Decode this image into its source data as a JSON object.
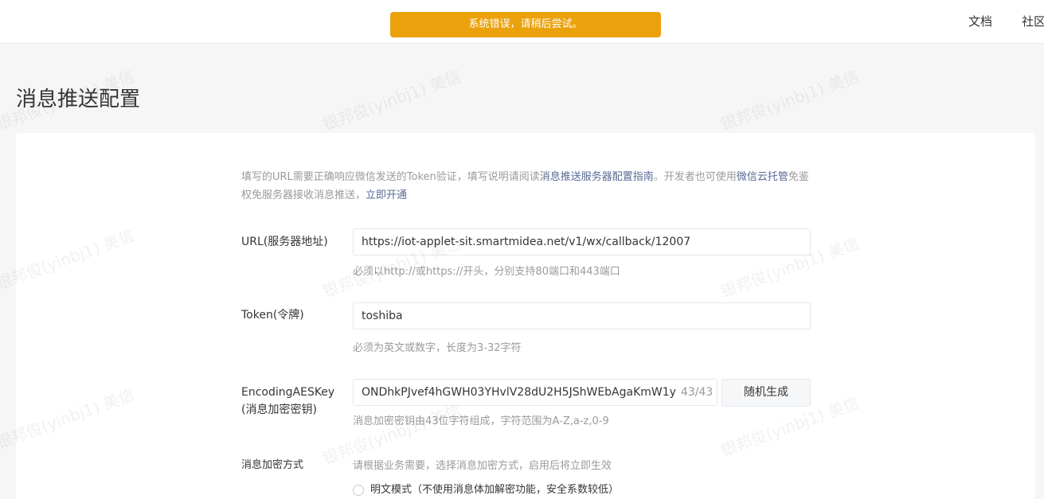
{
  "toast": {
    "message": "系统错误，请稍后尝试。"
  },
  "nav": {
    "docs": "文档",
    "community": "社区"
  },
  "page": {
    "title": "消息推送配置"
  },
  "intro": {
    "text1": "填写的URL需要正确响应微信发送的Token验证，填写说明请阅读",
    "link1": "消息推送服务器配置指南",
    "text2": "。开发者也可使用",
    "link2": "微信云托管",
    "text3": "免鉴权免服务器接收消息推送，",
    "link3": "立即开通"
  },
  "url_field": {
    "label": "URL(服务器地址)",
    "value": "https://iot-applet-sit.smartmidea.net/v1/wx/callback/12007",
    "hint": "必须以http://或https://开头，分别支持80端口和443端口"
  },
  "token_field": {
    "label": "Token(令牌)",
    "value": "toshiba",
    "hint": "必须为英文或数字，长度为3-32字符"
  },
  "aes_field": {
    "label_line1": "EncodingAESKey",
    "label_line2": "(消息加密密钥)",
    "value": "ONDhkPJvef4hGWH03YHvlV28dU2H5JShWEbAgaKmW1y",
    "counter": "43/43",
    "generate_button": "随机生成",
    "hint": "消息加密密钥由43位字符组成，字符范围为A-Z,a-z,0-9"
  },
  "encrypt_mode": {
    "label": "消息加密方式",
    "hint": "请根据业务需要，选择消息加密方式，启用后将立即生效",
    "option1": "明文模式（不使用消息体加解密功能，安全系数较低）"
  },
  "watermark": "银邦俊(yinbj1) 美信"
}
